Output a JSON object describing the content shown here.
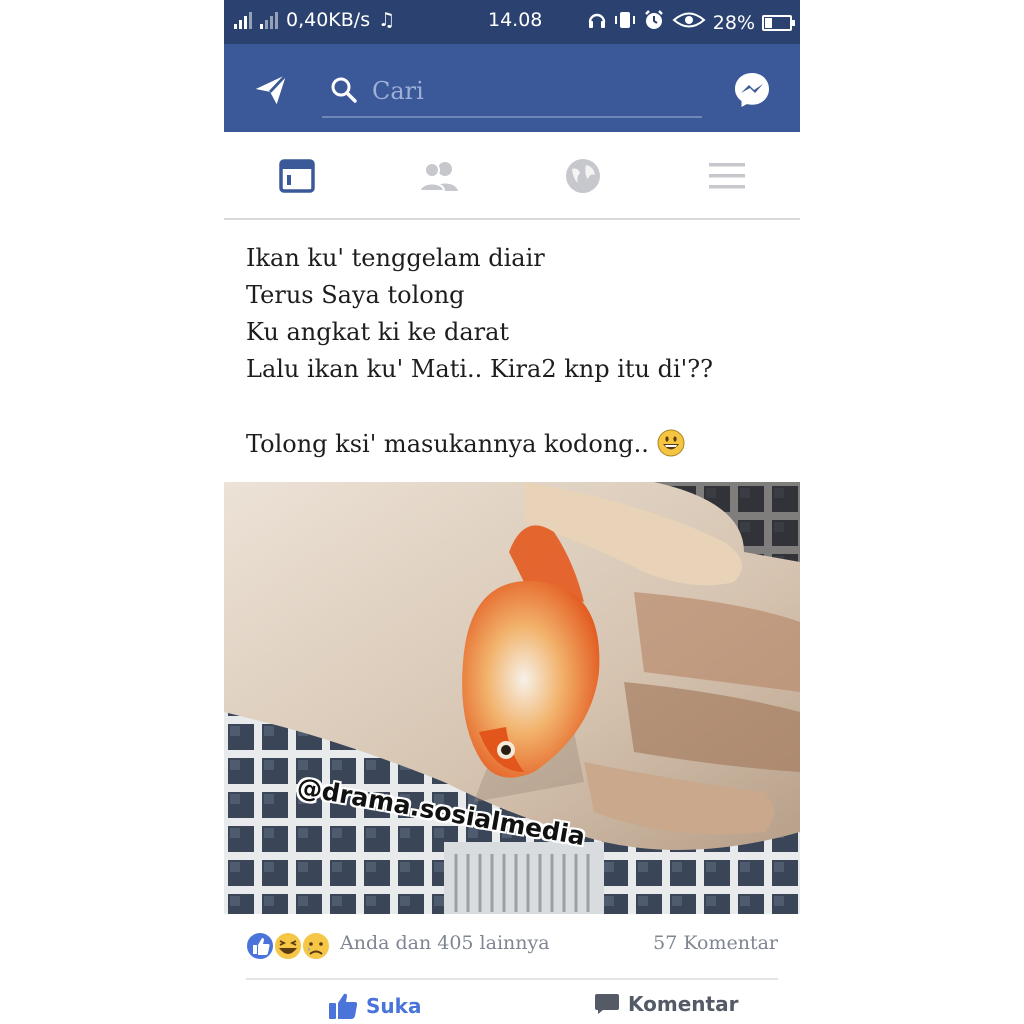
{
  "status_bar": {
    "network_speed": "0,40KB/s",
    "time": "14.08",
    "battery": "28%",
    "battery_level": 0.28
  },
  "appbar": {
    "search_placeholder": "Cari"
  },
  "tabs": [
    {
      "name": "news-feed",
      "active": true
    },
    {
      "name": "friends",
      "active": false
    },
    {
      "name": "notifications",
      "active": false
    },
    {
      "name": "menu",
      "active": false
    }
  ],
  "post": {
    "lines": [
      "Ikan ku' tenggelam diair",
      "Terus Saya tolong",
      "Ku angkat ki ke darat",
      "Lalu ikan ku' Mati.. Kira2 knp itu di'??"
    ],
    "closing_line": "Tolong ksi' masukannya kodong..",
    "watermark": "@drama.sosialmedia",
    "reactions_text": "Anda dan 405 lainnya",
    "comments_text": "57 Komentar"
  },
  "actions": {
    "like_label": "Suka",
    "comment_label": "Komentar"
  },
  "colors": {
    "status_bar": "#2b4270",
    "app_bar": "#3b5998",
    "like_blue": "#4a74d9",
    "tab_active": "#3b5998",
    "tab_inactive": "#c6c8cd"
  }
}
